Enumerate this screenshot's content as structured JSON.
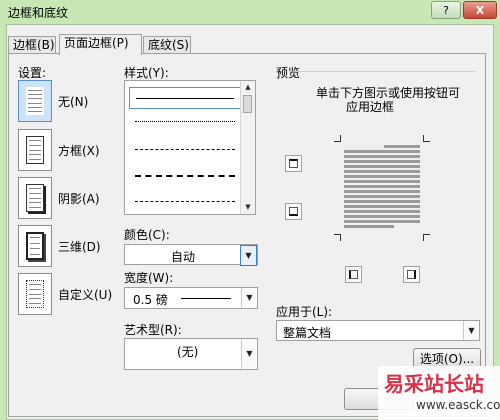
{
  "window": {
    "title": "边框和底纹",
    "help_label": "?",
    "close_label": "X"
  },
  "tabs": [
    {
      "label": "边框(B)",
      "active": false
    },
    {
      "label": "页面边框(P)",
      "active": true
    },
    {
      "label": "底纹(S)",
      "active": false
    }
  ],
  "settings": {
    "label": "设置:",
    "items": [
      {
        "label": "无(N)",
        "icon": "no-border-icon",
        "selected": true
      },
      {
        "label": "方框(X)",
        "icon": "box-border-icon",
        "selected": false
      },
      {
        "label": "阴影(A)",
        "icon": "shadow-border-icon",
        "selected": false
      },
      {
        "label": "三维(D)",
        "icon": "3d-border-icon",
        "selected": false
      },
      {
        "label": "自定义(U)",
        "icon": "custom-border-icon",
        "selected": false
      }
    ]
  },
  "style": {
    "label": "样式(Y):",
    "line_styles": [
      "solid",
      "dotted",
      "dashed-small",
      "dashed-large",
      "dash-dot"
    ]
  },
  "color": {
    "label": "颜色(C):",
    "value": "自动"
  },
  "width": {
    "label": "宽度(W):",
    "value": "0.5 磅"
  },
  "art": {
    "label": "艺术型(R):",
    "value": "(无)"
  },
  "preview": {
    "label": "预览",
    "instruction_line1": "单击下方图示或使用按钮可",
    "instruction_line2": "应用边框"
  },
  "apply_to": {
    "label": "应用于(L):",
    "value": "整篇文档"
  },
  "options_button": "选项(O)...",
  "watermark": {
    "text": "易采站长站",
    "url": "www.easck.com"
  },
  "colors": {
    "title_bar": "#c7e7b4",
    "dialog_bg": "#f0f0f0",
    "selection_blue": "#cfe3f7"
  }
}
